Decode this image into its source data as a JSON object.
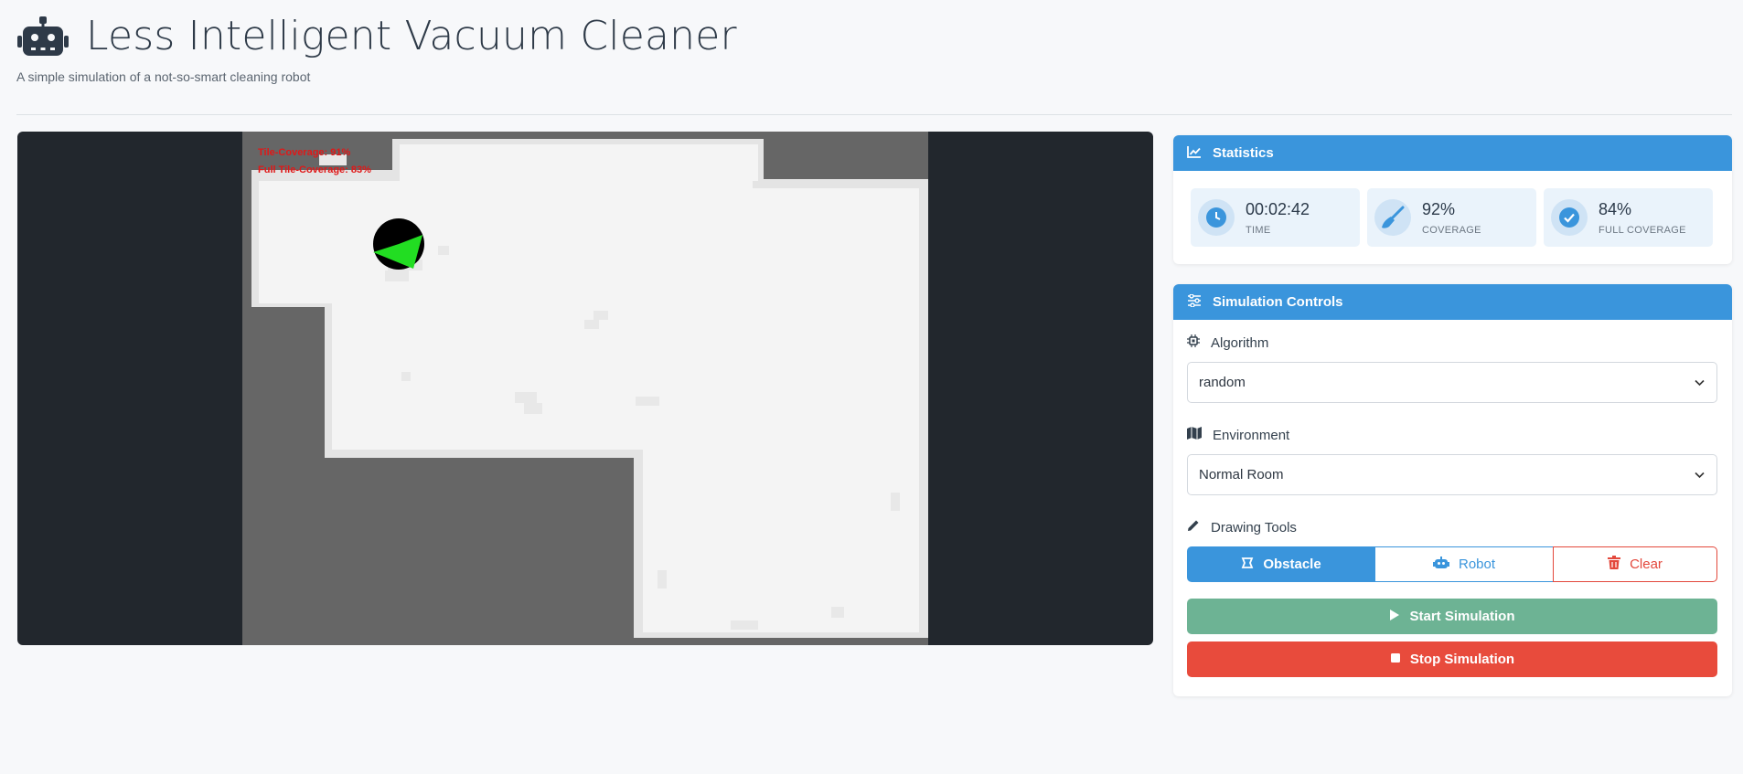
{
  "app": {
    "title": "Less Intelligent Vacuum Cleaner",
    "subtitle": "A simple simulation of a not-so-smart cleaning robot",
    "icon": "robot-icon"
  },
  "canvas": {
    "tile_coverage_text": "Tile-Coverage: 91%",
    "full_tile_coverage_text": "Full Tile-Coverage: 83%"
  },
  "statistics": {
    "header": "Statistics",
    "time": {
      "value": "00:02:42",
      "label": "TIME",
      "icon": "clock-icon"
    },
    "coverage": {
      "value": "92%",
      "label": "COVERAGE",
      "icon": "broom-icon"
    },
    "full_coverage": {
      "value": "84%",
      "label": "FULL COVERAGE",
      "icon": "check-circle-icon"
    }
  },
  "controls": {
    "header": "Simulation Controls",
    "algorithm": {
      "label": "Algorithm",
      "value": "random"
    },
    "environment": {
      "label": "Environment",
      "value": "Normal Room"
    },
    "drawing_tools": {
      "label": "Drawing Tools",
      "obstacle": "Obstacle",
      "robot": "Robot",
      "clear": "Clear"
    },
    "start_label": "Start Simulation",
    "stop_label": "Stop Simulation"
  },
  "colors": {
    "accent": "#3a95dc",
    "start": "#6db394",
    "stop": "#e84b3c",
    "canvas_bg": "#22272d",
    "floor_clean": "#f4f4f4",
    "wall": "#666666",
    "robot_body": "#000000",
    "robot_heading": "#22dd22",
    "coverage_text": "#e01818"
  }
}
